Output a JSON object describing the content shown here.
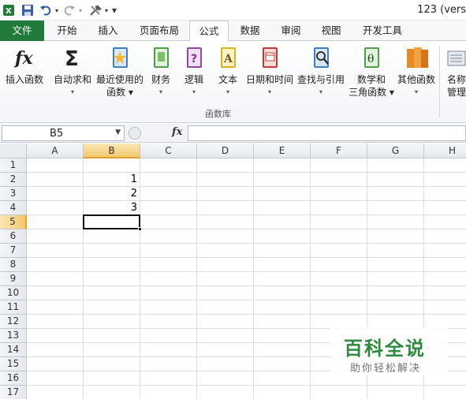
{
  "title_bar": {
    "title": "123 (vers"
  },
  "quick_access": {
    "customize_glyph": "▾"
  },
  "tabs": [
    {
      "label": "文件"
    },
    {
      "label": "开始"
    },
    {
      "label": "插入"
    },
    {
      "label": "页面布局"
    },
    {
      "label": "公式"
    },
    {
      "label": "数据"
    },
    {
      "label": "审阅"
    },
    {
      "label": "视图"
    },
    {
      "label": "开发工具"
    }
  ],
  "active_tab": "公式",
  "ribbon": {
    "buttons": [
      {
        "line1": "插入函数",
        "line2": "",
        "icon": "fx-icon"
      },
      {
        "line1": "自动求和",
        "line2": "▾",
        "icon": "sigma-icon"
      },
      {
        "line1": "最近使用的",
        "line2": "函数 ▾",
        "icon": "star-book-icon"
      },
      {
        "line1": "财务",
        "line2": "▾",
        "icon": "finance-book-icon"
      },
      {
        "line1": "逻辑",
        "line2": "▾",
        "icon": "logic-book-icon"
      },
      {
        "line1": "文本",
        "line2": "▾",
        "icon": "text-book-icon"
      },
      {
        "line1": "日期和时间",
        "line2": "▾",
        "icon": "date-book-icon"
      },
      {
        "line1": "查找与引用",
        "line2": "▾",
        "icon": "lookup-book-icon"
      },
      {
        "line1": "数学和",
        "line2": "三角函数 ▾",
        "icon": "math-book-icon"
      },
      {
        "line1": "其他函数",
        "line2": "▾",
        "icon": "more-books-icon"
      },
      {
        "line1": "名称",
        "line2": "管理",
        "icon": "name-manager-icon"
      }
    ],
    "group_label": "函数库"
  },
  "formula_bar": {
    "name_box": "B5",
    "fx_label": "fx",
    "formula": ""
  },
  "columns": [
    "A",
    "B",
    "C",
    "D",
    "E",
    "F",
    "G",
    "H"
  ],
  "rows": [
    "1",
    "2",
    "3",
    "4",
    "5",
    "6",
    "7",
    "8",
    "9",
    "10",
    "11",
    "12",
    "13",
    "14",
    "15",
    "16",
    "17"
  ],
  "cells": {
    "B2": "1",
    "B3": "2",
    "B4": "3"
  },
  "selected_cell": "B5",
  "watermark": {
    "title": "百科全说",
    "subtitle": "助你轻松解决"
  },
  "colors": {
    "file_tab": "#217a3a",
    "selection_header": "#f4c96c",
    "watermark": "#2f8a3f"
  }
}
